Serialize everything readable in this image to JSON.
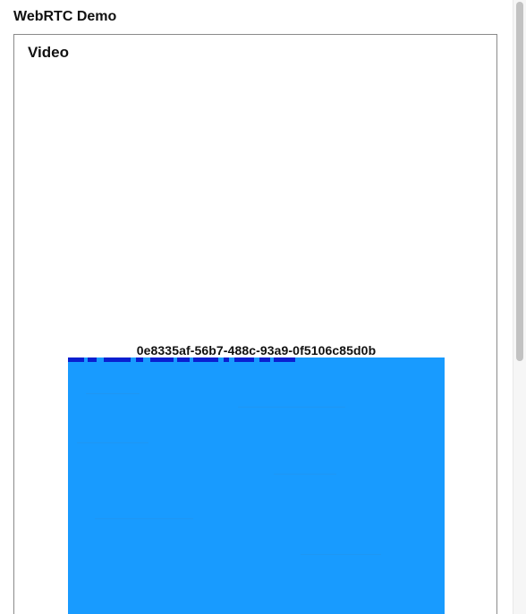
{
  "app": {
    "title": "WebRTC Demo"
  },
  "video_section": {
    "title": "Video",
    "stream_id": "0e8335af-56b7-488c-93a9-0f5106c85d0b"
  },
  "colors": {
    "video_fill": "#189bff",
    "glitch": "#0a1fd0"
  }
}
